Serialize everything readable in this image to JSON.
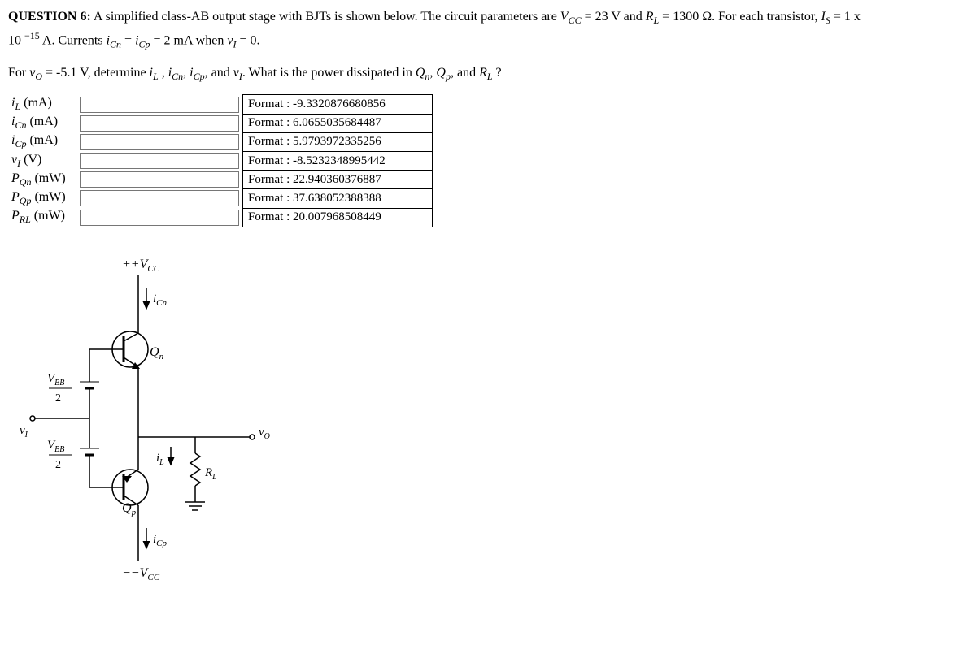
{
  "question": {
    "label": "QUESTION 6:",
    "intro1": " A simplified class-AB output stage with BJTs is shown below. The circuit parameters are ",
    "vcc_sym": "V",
    "vcc_sub": "CC",
    "eq": " = ",
    "vcc_val": "23 V and ",
    "rl_sym": "R",
    "rl_sub": "L",
    "rl_val": " = 1300 Ω. For each transistor, ",
    "is_sym": "I",
    "is_sub": "S",
    "is_val": " = 1 x",
    "ten": "10 ",
    "exp": "−15",
    "intro2": " A. Currents ",
    "icn_sym": "i",
    "icn_sub": "Cn",
    "eq2": " = ",
    "icp_sym": "i",
    "icp_sub": "Cp",
    "q_val": " = 2 mA when ",
    "vi_sym": "v",
    "vi_sub": "I",
    "vi_zero": " = 0.",
    "para2_a": "For ",
    "vo_sym": "v",
    "vo_sub": "O",
    "vo_val": " = -5.1 V, determine ",
    "il_sym": "i",
    "il_sub": "L",
    "comma": " , ",
    "and": " and ",
    "end1": ". What is the power dissipated in ",
    "qn_sym": "Q",
    "qn_sub": "n",
    "qp_sym": "Q",
    "qp_sub": "p",
    "end2": " ?"
  },
  "rows": [
    {
      "sym": "i",
      "sub": "L",
      "unit": " (mA)",
      "format": "Format : -9.3320876680856"
    },
    {
      "sym": "i",
      "sub": "Cn",
      "unit": " (mA)",
      "format": "Format : 6.0655035684487"
    },
    {
      "sym": "i",
      "sub": "Cp",
      "unit": " (mA)",
      "format": "Format : 5.9793972335256"
    },
    {
      "sym": "v",
      "sub": "I",
      "unit": " (V)",
      "format": "Format : -8.5232348995442"
    },
    {
      "sym": "P",
      "sub": "Qn",
      "unit": " (mW)",
      "format": "Format : 22.940360376887"
    },
    {
      "sym": "P",
      "sub": "Qp",
      "unit": " (mW)",
      "format": "Format : 37.638052388388"
    },
    {
      "sym": "P",
      "sub": "RL",
      "unit": " (mW)",
      "format": "Format : 20.007968508449"
    }
  ],
  "circuit": {
    "pos_rail": "+V",
    "pos_rail_sub": "CC",
    "neg_rail": "−V",
    "neg_rail_sub": "CC",
    "icn": "i",
    "icn_sub": "Cn",
    "icp": "i",
    "icp_sub": "Cp",
    "qn": "Q",
    "qn_sub": "n",
    "qp": "Q",
    "qp_sub": "p",
    "vbb": "V",
    "vbb_sub": "BB",
    "two": "2",
    "vi": "v",
    "vi_sub": "I",
    "vo": "v",
    "vo_sub": "O",
    "il": "i",
    "il_sub": "L",
    "rl": "R",
    "rl_sub": "L"
  }
}
